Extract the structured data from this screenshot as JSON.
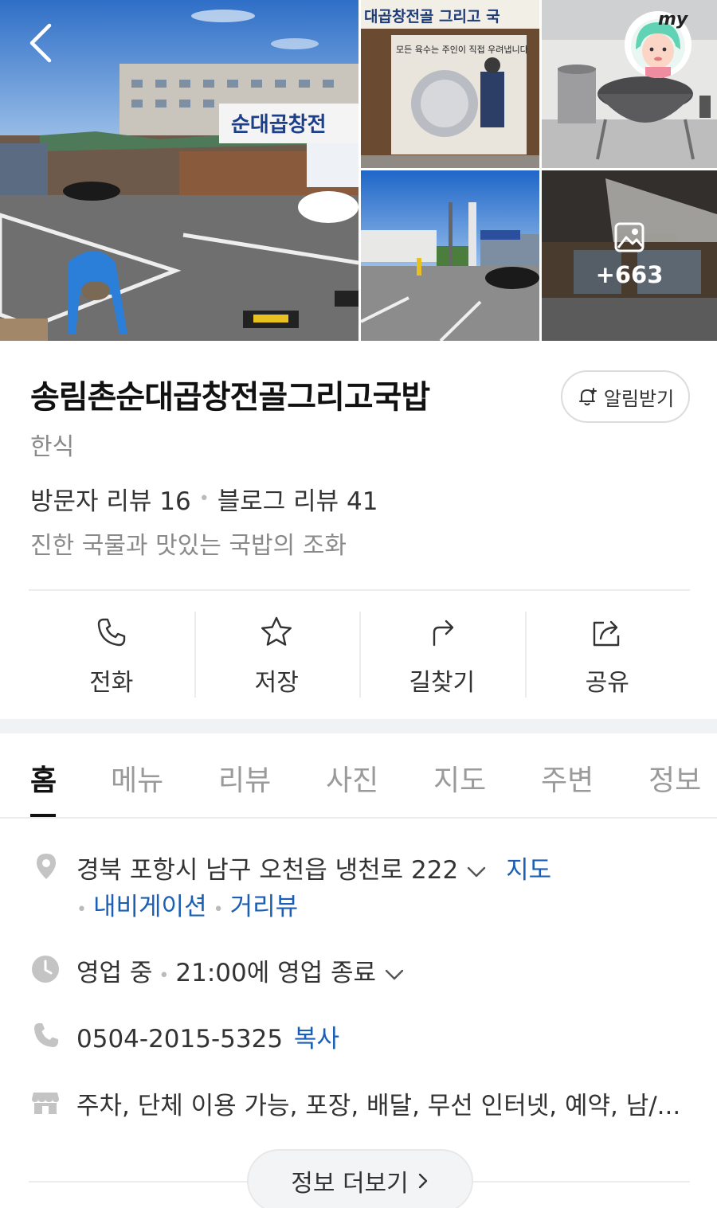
{
  "gallery": {
    "more_count": "+663",
    "main_photo_sign": "순대곱창전",
    "photo2_sign": "대곱창전골 그리고 국",
    "photo2_banner": "모든 육수는 주인이 직접 우려냅니다",
    "my_badge": "my"
  },
  "place": {
    "name": "송림촌순대곱창전골그리고국밥",
    "category": "한식",
    "visitor_reviews": "방문자 리뷰 16",
    "blog_reviews": "블로그 리뷰 41",
    "tagline": "진한 국물과 맛있는 국밥의 조화",
    "notify_label": "알림받기"
  },
  "actions": [
    {
      "label": "전화",
      "icon": "phone-icon"
    },
    {
      "label": "저장",
      "icon": "star-icon"
    },
    {
      "label": "길찾기",
      "icon": "directions-icon"
    },
    {
      "label": "공유",
      "icon": "share-icon"
    }
  ],
  "tabs": [
    "홈",
    "메뉴",
    "리뷰",
    "사진",
    "지도",
    "주변",
    "정보"
  ],
  "active_tab": "홈",
  "info": {
    "address": "경북 포항시 남구 오천읍 냉천로 222",
    "map_link": "지도",
    "navigation_link": "내비게이션",
    "streetview_link": "거리뷰",
    "status": "영업 중",
    "hours": "21:00에 영업 종료",
    "phone": "0504-2015-5325",
    "copy_label": "복사",
    "amenities": "주차, 단체 이용 가능, 포장, 배달, 무선 인터넷, 예약, 남/...",
    "more_info_label": "정보 더보기"
  },
  "colors": {
    "link": "#1a5fb4",
    "muted": "#8a8a8a",
    "divider": "#ececec"
  }
}
